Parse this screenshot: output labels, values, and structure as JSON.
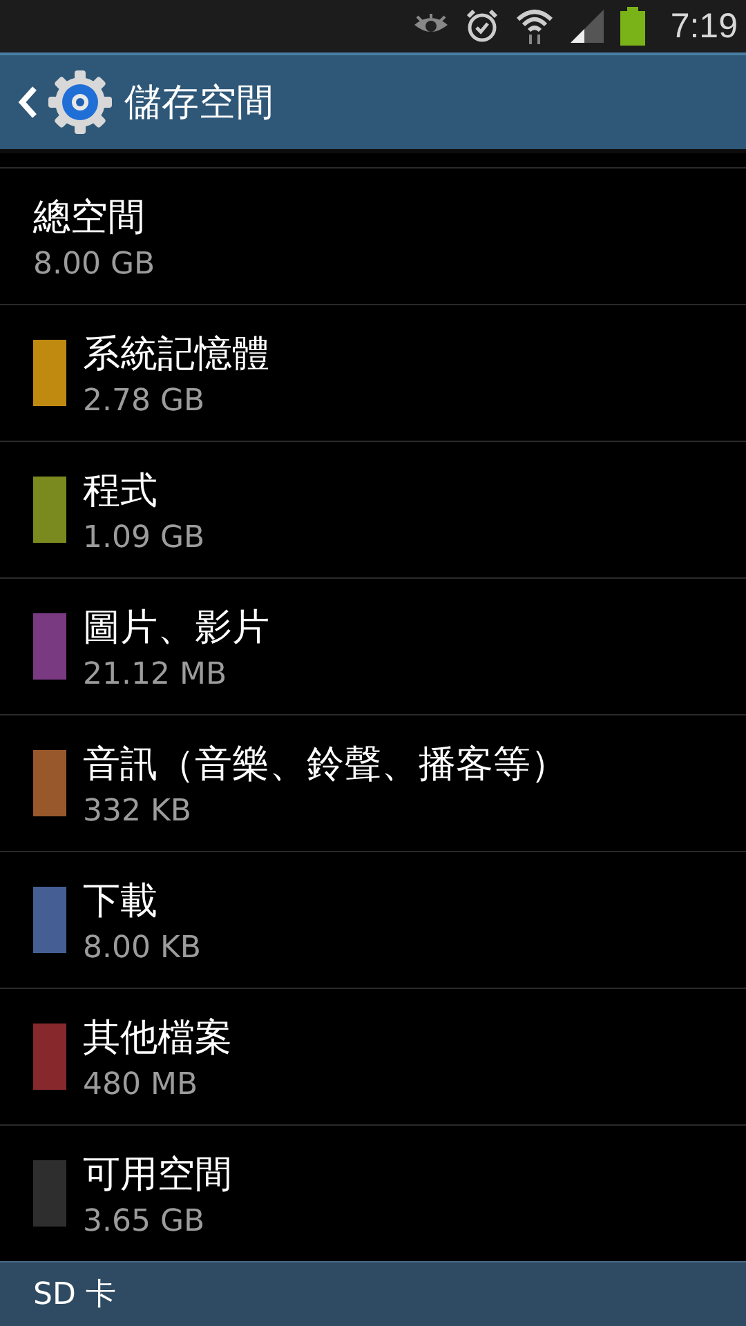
{
  "status_bar": {
    "time": "7:19"
  },
  "header": {
    "title": "儲存空間"
  },
  "items": [
    {
      "kind": "total",
      "label": "總空間",
      "size": "8.00 GB"
    },
    {
      "kind": "category",
      "label": "系統記憶體",
      "size": "2.78 GB",
      "color": "#c08a10"
    },
    {
      "kind": "category",
      "label": "程式",
      "size": "1.09 GB",
      "color": "#7b8a1e"
    },
    {
      "kind": "category",
      "label": "圖片、影片",
      "size": "21.12 MB",
      "color": "#7a3a82"
    },
    {
      "kind": "category",
      "label": "音訊（音樂、鈴聲、播客等）",
      "size": "332 KB",
      "color": "#98582c"
    },
    {
      "kind": "category",
      "label": "下載",
      "size": "8.00 KB",
      "color": "#455f94"
    },
    {
      "kind": "category",
      "label": "其他檔案",
      "size": "480 MB",
      "color": "#86282c"
    },
    {
      "kind": "category",
      "label": "可用空間",
      "size": "3.65 GB",
      "color": "#2e2e2e"
    }
  ],
  "section": {
    "title": "SD 卡"
  }
}
